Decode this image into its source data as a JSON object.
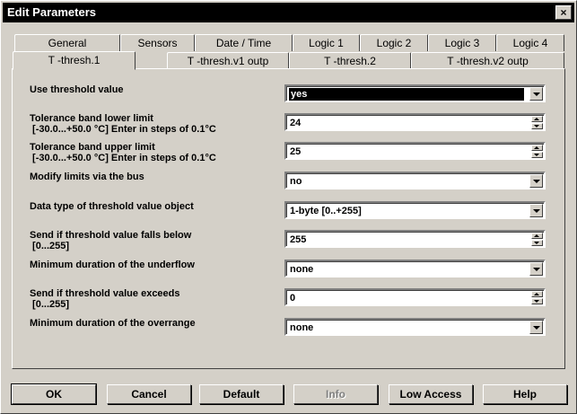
{
  "window": {
    "title": "Edit Parameters",
    "close_glyph": "×"
  },
  "tabs_row1": [
    "General",
    "Sensors",
    "Date / Time",
    "Logic 1",
    "Logic 2",
    "Logic 3",
    "Logic 4"
  ],
  "tabs_row2": [
    "T -thresh.1",
    "T -thresh.v1 outp",
    "T -thresh.2",
    "T -thresh.v2 outp"
  ],
  "active_tab": "T -thresh.1",
  "params": [
    {
      "label": "Use threshold value",
      "value": "yes",
      "control": "dropdown",
      "focused": true
    },
    {
      "label": "Tolerance band lower limit\n [-30.0...+50.0 °C] Enter in steps of 0.1°C",
      "value": "24",
      "control": "spin"
    },
    {
      "label": "Tolerance band upper limit\n [-30.0...+50.0 °C] Enter in steps of 0.1°C",
      "value": "25",
      "control": "spin"
    },
    {
      "label": "Modify limits via the bus",
      "value": "no",
      "control": "dropdown"
    },
    {
      "label": "Data type of threshold value object",
      "value": "1-byte [0..+255]",
      "control": "dropdown"
    },
    {
      "label": "Send if threshold value falls below\n [0...255]",
      "value": "255",
      "control": "spin"
    },
    {
      "label": "Minimum duration of the underflow",
      "value": "none",
      "control": "dropdown"
    },
    {
      "label": "Send if threshold value exceeds\n [0...255]",
      "value": "0",
      "control": "spin"
    },
    {
      "label": "Minimum duration of the overrange",
      "value": "none",
      "control": "dropdown"
    }
  ],
  "buttons": {
    "ok": "OK",
    "cancel": "Cancel",
    "default": "Default",
    "info": "Info",
    "low_access": "Low Access",
    "help": "Help"
  }
}
